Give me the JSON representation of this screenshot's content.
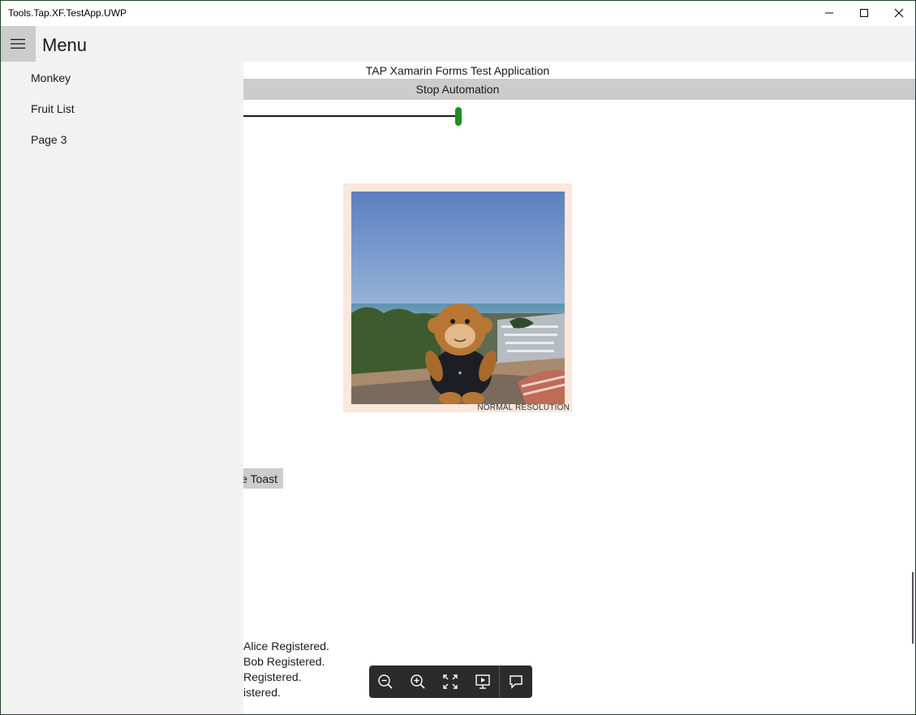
{
  "window": {
    "title": "Tools.Tap.XF.TestApp.UWP",
    "controls": [
      "minimize-icon",
      "maximize-icon",
      "close-icon"
    ]
  },
  "header": {
    "menu_title": "Menu",
    "hamburger_icon": "hamburger-icon"
  },
  "flyout": {
    "items": [
      {
        "label": "Monkey"
      },
      {
        "label": "Fruit List"
      },
      {
        "label": "Page 3"
      }
    ]
  },
  "content": {
    "heading": "TAP Xamarin Forms Test Application",
    "stop_button_label": "Stop Automation",
    "slider": {
      "value_fraction": 0.32,
      "thumb_color": "#1f8f1f"
    },
    "image_caption": "NORMAL RESOLUTION",
    "toast_button_label": "e Toast",
    "log_lines": [
      "Alice Registered.",
      "Bob Registered.",
      "Registered.",
      "istered."
    ]
  },
  "toolbar": {
    "icons": [
      "zoom-out-icon",
      "zoom-in-icon",
      "fit-screen-icon",
      "present-icon",
      "comment-icon"
    ]
  },
  "colors": {
    "pane_background": "#f2f2f2",
    "button_gray": "#cccccc",
    "accent_green": "#1f8f1f",
    "toolbar_background": "#2b2b2b"
  }
}
